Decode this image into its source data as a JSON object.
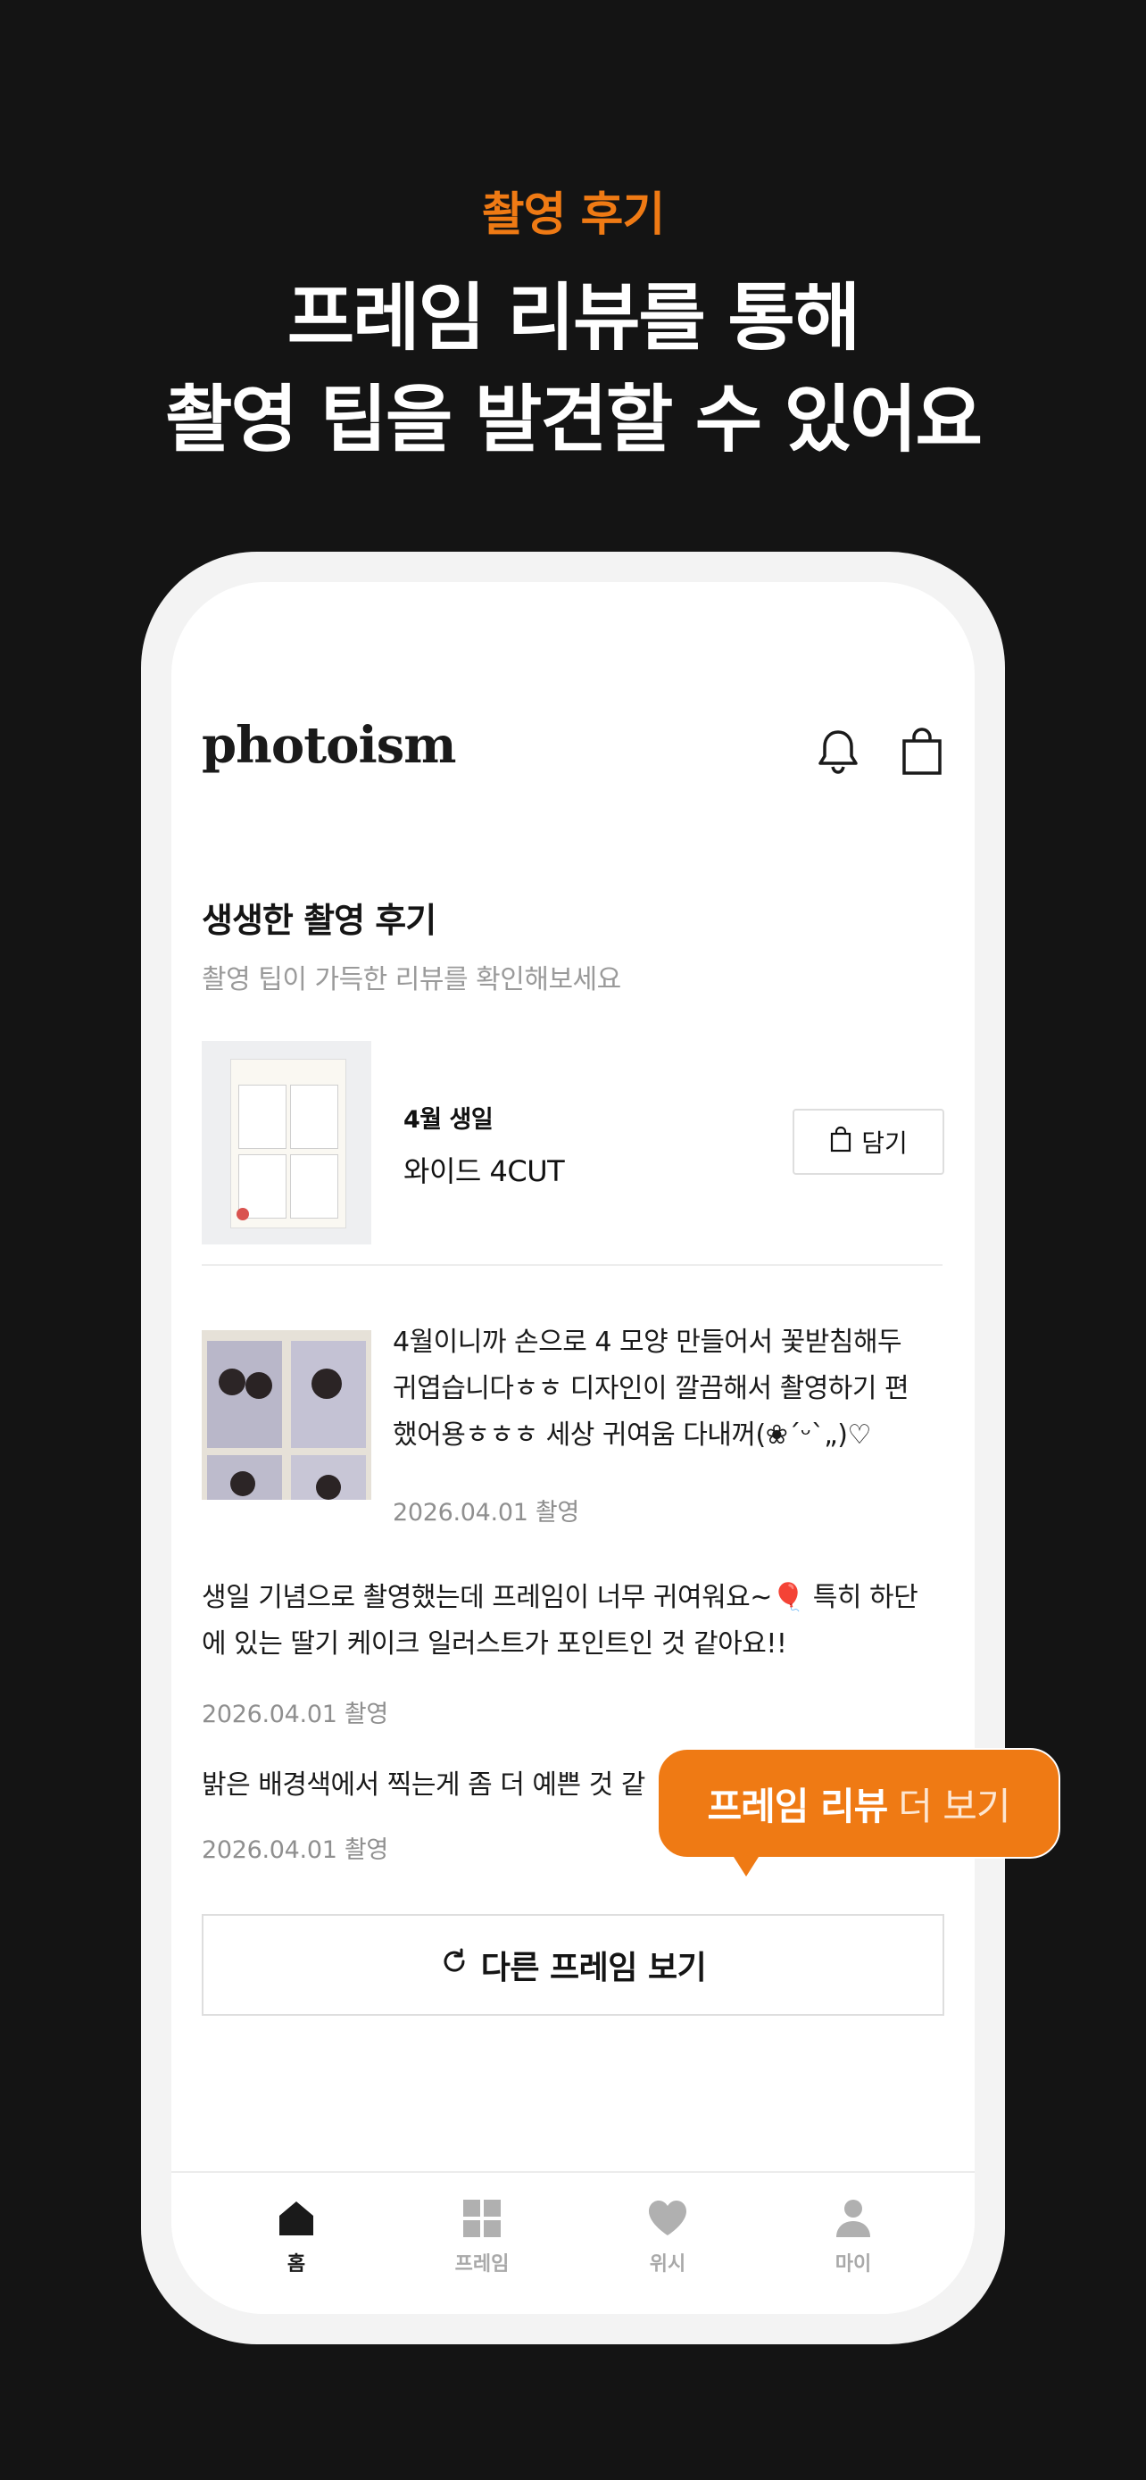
{
  "hero": {
    "eyebrow": "촬영 후기",
    "title_line1": "프레임 리뷰를 통해",
    "title_line2": "촬영 팁을 발견할 수 있어요"
  },
  "header": {
    "logo": "photoism",
    "bell_icon": "bell-icon",
    "bag_icon": "shopping-bag-icon"
  },
  "section": {
    "title": "생생한 촬영 후기",
    "subtitle": "촬영 팁이 가득한 리뷰를 확인해보세요"
  },
  "frame": {
    "tag": "4월 생일",
    "name": "와이드 4CUT",
    "cart_label": "담기"
  },
  "reviews": [
    {
      "lines": [
        "4월이니까 손으로 4 모양 만들어서 꽃받침해두",
        "귀엽습니다ㅎㅎ 디자인이 깔끔해서 촬영하기 편",
        "했어용ㅎㅎㅎ 세상 귀여움 다내꺼(❀ˊᵕˋ„)♡"
      ],
      "date": "2026.04.01 촬영"
    },
    {
      "lines": [
        "생일 기념으로 촬영했는데 프레임이 너무 귀여워요~🎈 특히 하단",
        "에 있는 딸기 케이크 일러스트가 포인트인 것 같아요!!"
      ],
      "date": "2026.04.01 촬영"
    },
    {
      "lines": [
        "밝은 배경색에서 찍는게 좀 더 예쁜 것 같"
      ],
      "date": "2026.04.01 촬영"
    }
  ],
  "more_button": "다른 프레임 보기",
  "tooltip": {
    "strong": "프레임 리뷰",
    "light": "더 보기"
  },
  "tabs": [
    {
      "label": "홈",
      "icon": "home-icon",
      "active": true
    },
    {
      "label": "프레임",
      "icon": "grid-icon",
      "active": false
    },
    {
      "label": "위시",
      "icon": "heart-icon",
      "active": false
    },
    {
      "label": "마이",
      "icon": "person-icon",
      "active": false
    }
  ],
  "colors": {
    "accent": "#ef7a14",
    "background": "#141414"
  }
}
